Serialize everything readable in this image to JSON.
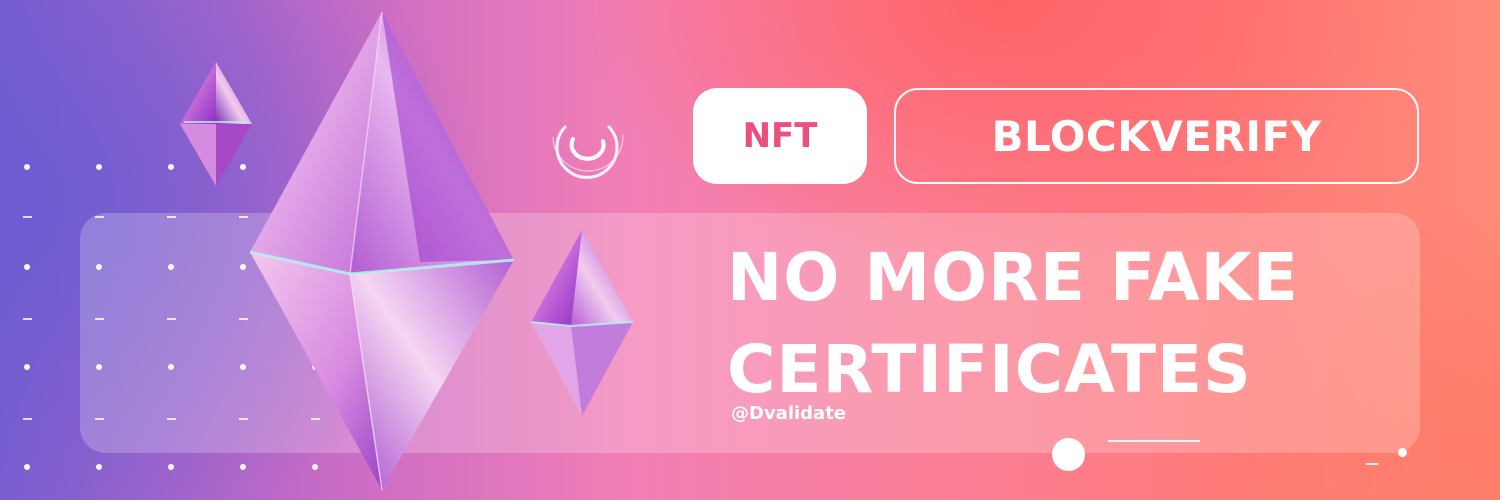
{
  "tags": {
    "nft_label": "NFT",
    "brand_label": "BLOCKVERIFY"
  },
  "headline": {
    "line1": "NO MORE FAKE",
    "line2": "CERTIFICATES"
  },
  "handle": "@Dvalidate",
  "colors": {
    "nft_text": "#e9507f",
    "accent_white": "#ffffff",
    "gradient_left": "#7a5ed0",
    "gradient_mid": "#f27fb6",
    "gradient_right": "#ff7a7a"
  },
  "icons": [
    "crystal-gem-icon",
    "crescent-ring-icon"
  ]
}
